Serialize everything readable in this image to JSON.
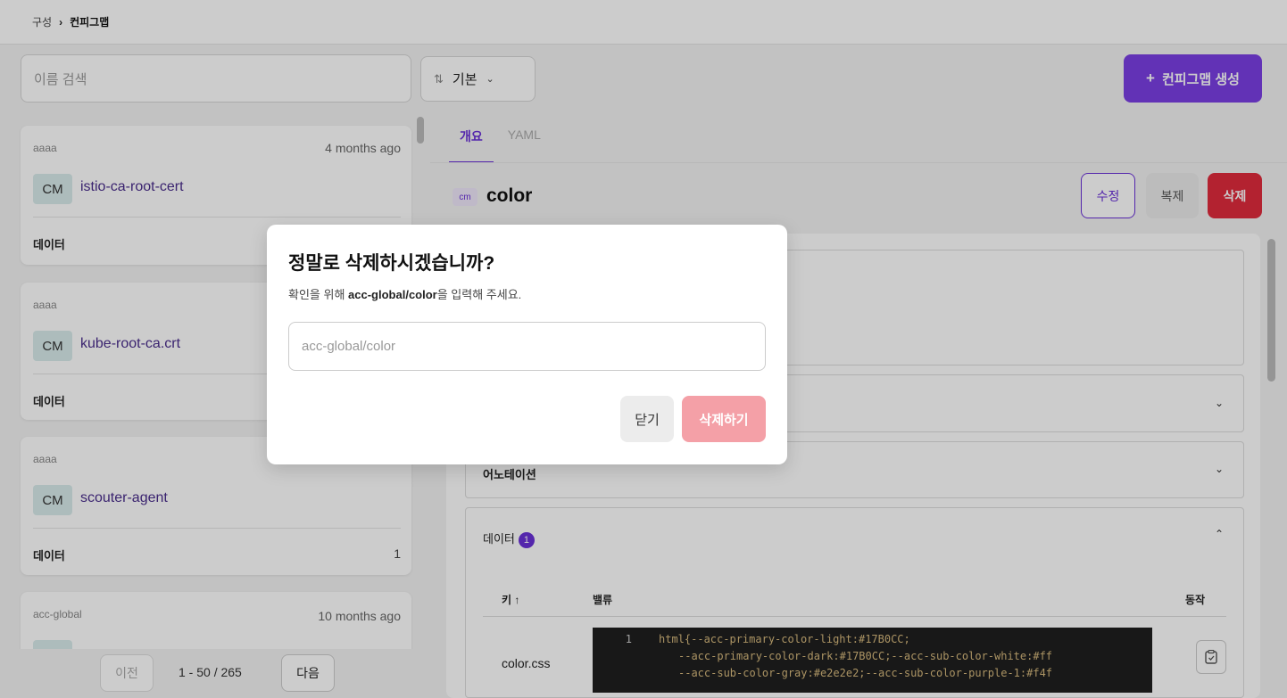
{
  "breadcrumb": {
    "root": "구성",
    "separator": "›",
    "current": "컨피그맵"
  },
  "toolbar": {
    "search_placeholder": "이름 검색",
    "sort_label": "기본",
    "create_label": "컨피그맵 생성"
  },
  "list": {
    "items": [
      {
        "namespace": "aaaa",
        "age": "4 months ago",
        "kind": "CM",
        "name": "istio-ca-root-cert",
        "data_label": "데이터",
        "data_count": ""
      },
      {
        "namespace": "aaaa",
        "age": "",
        "kind": "CM",
        "name": "kube-root-ca.crt",
        "data_label": "데이터",
        "data_count": ""
      },
      {
        "namespace": "aaaa",
        "age": "",
        "kind": "CM",
        "name": "scouter-agent",
        "data_label": "데이터",
        "data_count": "1"
      },
      {
        "namespace": "acc-global",
        "age": "10 months ago",
        "kind": "CM",
        "name": "",
        "data_label": "",
        "data_count": ""
      }
    ]
  },
  "pager": {
    "prev": "이전",
    "info": "1 - 50 / 265",
    "next": "다음"
  },
  "detail": {
    "tabs": [
      "개요",
      "YAML"
    ],
    "badge": "cm",
    "title": "color",
    "edit": "수정",
    "copy": "복제",
    "delete": "삭제",
    "sections": {
      "annotations": "어노테이션",
      "data": "데이터",
      "data_count": "1"
    },
    "table": {
      "col_key": "키",
      "col_value": "밸류",
      "col_action": "동작",
      "row_key": "color.css",
      "code_line_no": "1",
      "code_line1": "html{--acc-primary-color-light:#17B0CC;",
      "code_line2": "--acc-primary-color-dark:#17B0CC;--acc-sub-color-white:#ff",
      "code_line3": "--acc-sub-color-gray:#e2e2e2;--acc-sub-color-purple-1:#f4f"
    }
  },
  "modal": {
    "title": "정말로 삭제하시겠습니까?",
    "desc_prefix": "확인을 위해 ",
    "desc_target": "acc-global/color",
    "desc_suffix": "을 입력해 주세요.",
    "input_placeholder": "acc-global/color",
    "close": "닫기",
    "confirm": "삭제하기"
  },
  "colors": {
    "accent": "#7b3fe4",
    "danger": "#e02b3c",
    "danger_disabled": "#f4a0a7"
  }
}
